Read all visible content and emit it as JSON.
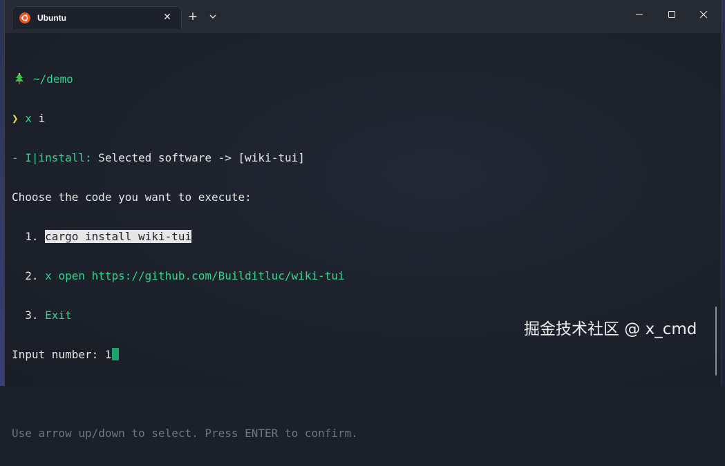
{
  "window": {
    "tab_title": "Ubuntu",
    "tab_icon": "ubuntu-icon",
    "new_tab_label": "+",
    "close_tab_label": "✕"
  },
  "terminal": {
    "prompt_dir": "~/demo",
    "prompt_symbol": "❯",
    "command_name": "x",
    "command_arg": "i",
    "install_prefix": "- I|install:",
    "install_message": "Selected software -> [wiki-tui]",
    "choose_prompt": "Choose the code you want to execute:",
    "options": [
      {
        "num": "1.",
        "text": "cargo install wiki-tui",
        "selected": true
      },
      {
        "num": "2.",
        "text": "x open https://github.com/Builditluc/wiki-tui",
        "selected": false
      },
      {
        "num": "3.",
        "text": "Exit",
        "selected": false
      }
    ],
    "input_label": "Input number:",
    "input_value": "1",
    "hint": "Use arrow up/down to select. Press ENTER to confirm."
  },
  "watermark": "掘金技术社区 @ x_cmd",
  "colors": {
    "accent_green": "#2ed58d",
    "prompt_yellow": "#e7d84c",
    "cursor": "#1aa36b",
    "ubuntu_orange": "#e95420"
  }
}
